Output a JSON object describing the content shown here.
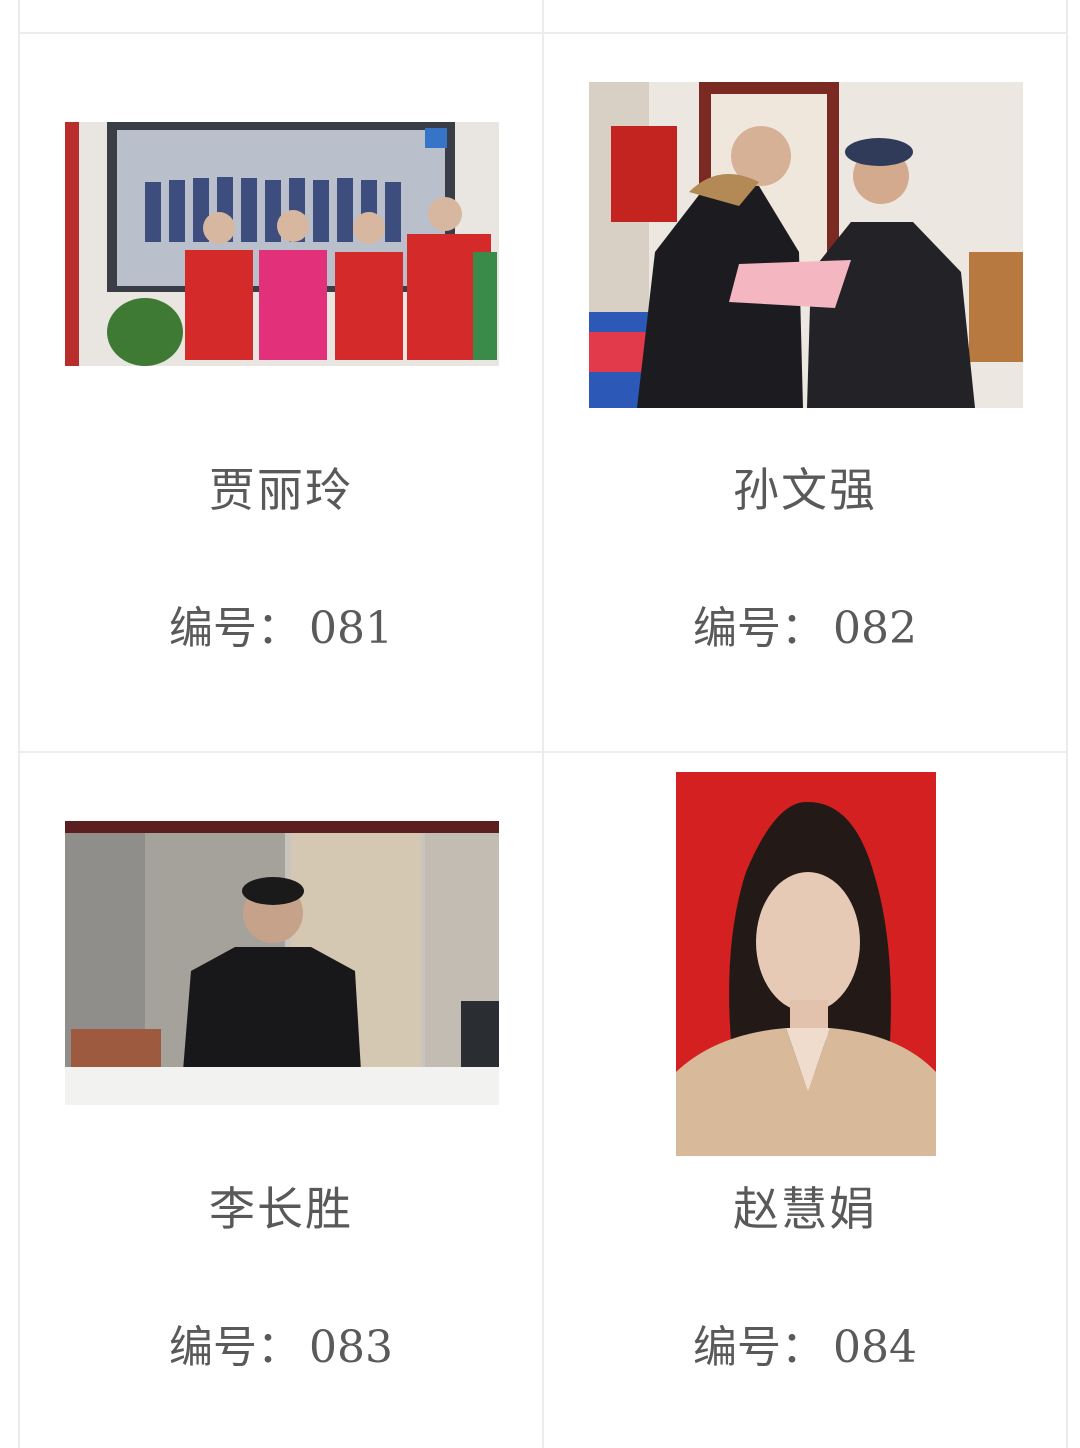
{
  "cards": [
    {
      "name": "贾丽玲",
      "number_label": "编号：",
      "number": "081",
      "photo": "group-volunteers-photo"
    },
    {
      "name": "孙文强",
      "number_label": "编号：",
      "number": "082",
      "photo": "visit-elderly-photo"
    },
    {
      "name": "李长胜",
      "number_label": "编号：",
      "number": "083",
      "photo": "seated-man-photo"
    },
    {
      "name": "赵慧娟",
      "number_label": "编号：",
      "number": "084",
      "photo": "portrait-woman-photo"
    }
  ],
  "colors": {
    "grid_line": "#ececec",
    "text": "#595959",
    "red_vest": "#d42a2a",
    "portrait_bg": "#d42020"
  }
}
